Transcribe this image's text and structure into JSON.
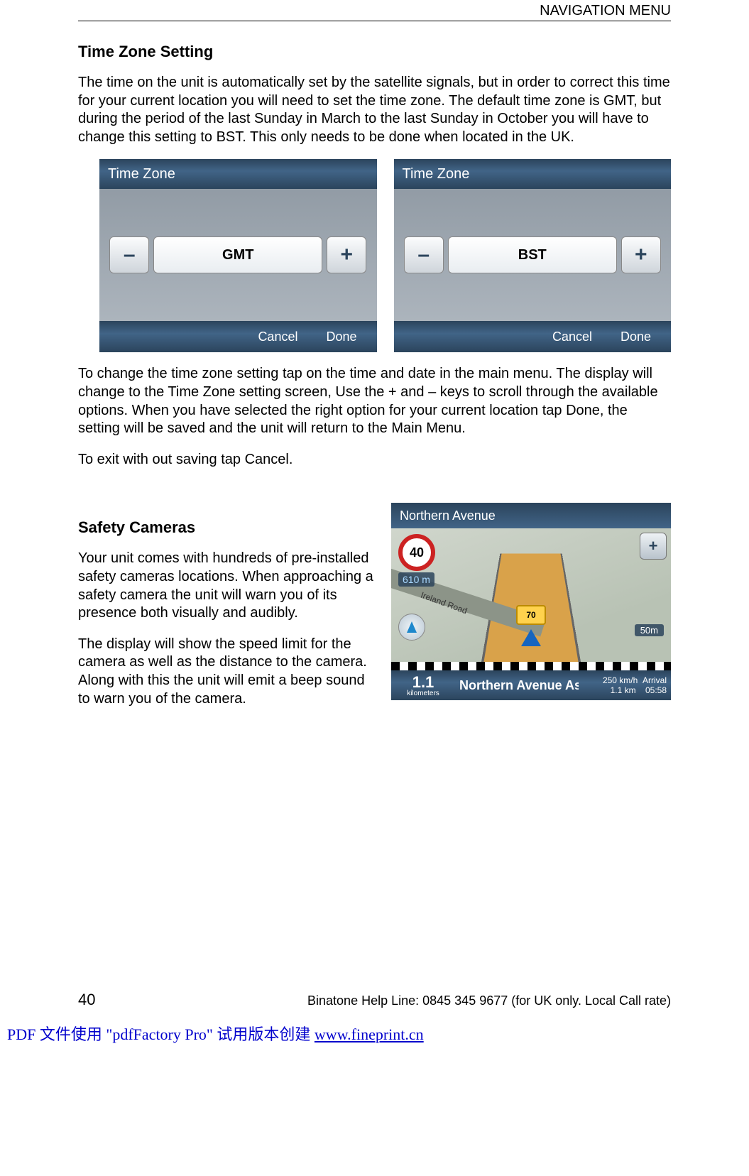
{
  "header": {
    "running_head": "NAVIGATION MENU"
  },
  "section1": {
    "title": "Time Zone Setting",
    "para1": "The time on the unit is automatically set by the satellite signals, but in order to correct this time for your current location you will need to set the time zone. The default time zone is GMT, but during the period of the last Sunday in March to the last Sunday in October you will have to change this setting to BST. This only needs to be done when located in the UK.",
    "para2": "To change the time zone setting tap on the time and date in the main menu. The display will change to the Time Zone setting screen, Use the + and – keys to scroll through the available options. When you have selected the right option for your current location tap Done, the setting will be saved and the unit will return to the Main Menu.",
    "para3": "To exit with out saving tap Cancel."
  },
  "timezone_screens": {
    "title": "Time Zone",
    "minus": "–",
    "plus": "+",
    "cancel": "Cancel",
    "done": "Done",
    "values": [
      "GMT",
      "BST"
    ]
  },
  "section2": {
    "title": "Safety Cameras",
    "para1": "Your unit comes with hundreds of pre-installed safety cameras locations. When approaching a safety camera the unit will warn you of its presence both visually and audibly.",
    "para2": "The display will show the speed limit for the camera as well as the distance to the camera. Along with this the unit will emit a beep sound to warn you of the camera."
  },
  "nav_screen": {
    "top_street": "Northern Avenue",
    "speed_limit": "40",
    "camera_distance": "610 m",
    "side_road": "Ireland Road",
    "camera_speed": "70",
    "scale": "50m",
    "plus": "+",
    "next_turn": {
      "distance": "1.1",
      "unit": "kilometers"
    },
    "current_street": "Northern Avenue Ash...",
    "stats": {
      "speed": "250 km/h",
      "remaining": "1.1 km",
      "arrival_label": "Arrival",
      "arrival_time": "05:58"
    }
  },
  "footer": {
    "page_number": "40",
    "helpline": "Binatone Help Line: 0845 345 9677 (for UK only. Local Call rate)"
  },
  "pdf_watermark": {
    "prefix": "PDF 文件使用 \"pdfFactory Pro\" 试用版本创建 ",
    "link_text": "www.fineprint.cn"
  }
}
